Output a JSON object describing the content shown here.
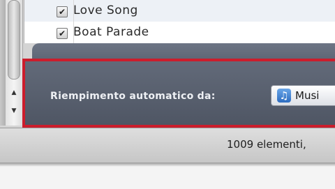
{
  "songs": [
    {
      "checked": true,
      "check_glyph": "✔",
      "name": "Love Song"
    },
    {
      "checked": true,
      "check_glyph": "✔",
      "name": "Boat Parade"
    }
  ],
  "scrollbar": {
    "up_glyph": "▲",
    "down_glyph": "▼"
  },
  "autofill": {
    "label": "Riempimento automatico da:",
    "source": "Musi",
    "source_icon": "music-note-icon",
    "source_icon_glyph": "♫"
  },
  "status": {
    "text": "1009 elementi,"
  },
  "colors": {
    "highlight_border": "#cc1d2c",
    "panel_bg": "#5b6372",
    "accent_blue": "#2c6cc0"
  }
}
